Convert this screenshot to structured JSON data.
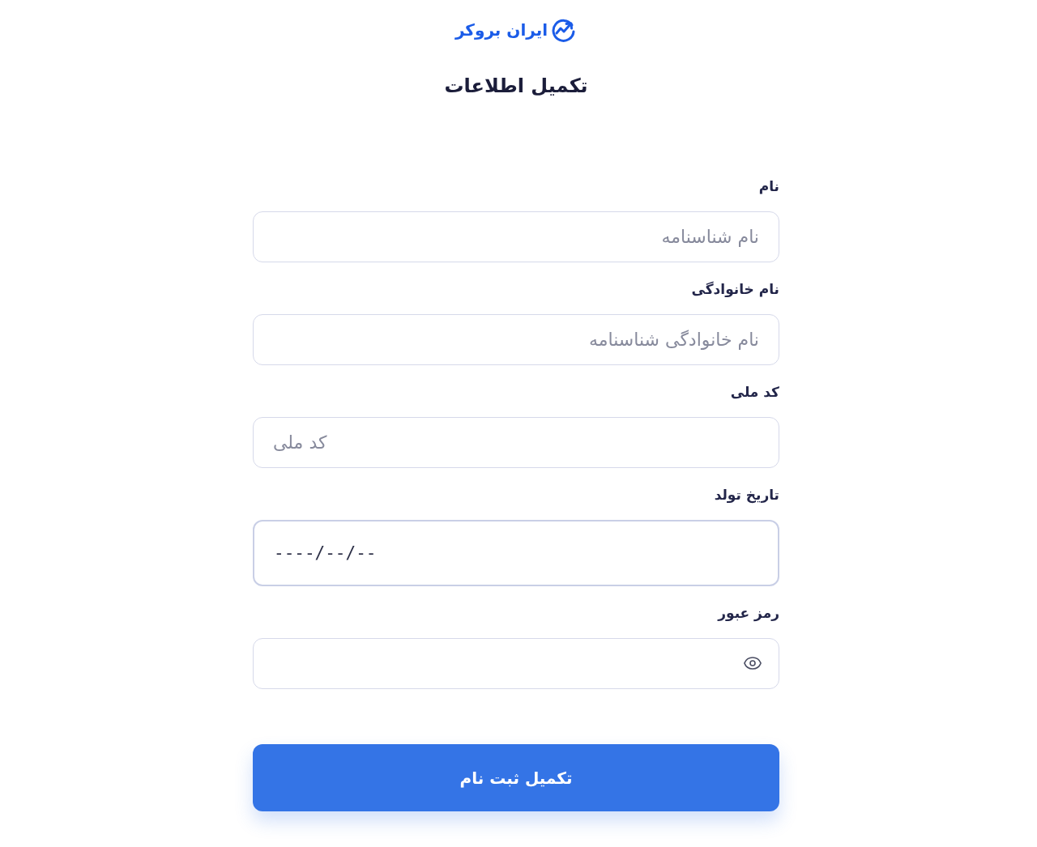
{
  "logo": {
    "text": "ایران بروکر"
  },
  "title": "تکمیل اطلاعات",
  "fields": [
    {
      "kind": "text",
      "label": "نام",
      "placeholder": "نام شناسنامه"
    },
    {
      "kind": "text",
      "label": "نام خانوادگی",
      "placeholder": "نام خانوادگی شناسنامه"
    },
    {
      "kind": "number",
      "label": "کد ملی",
      "placeholder": "کد ملی"
    },
    {
      "kind": "date",
      "label": "تاریخ تولد",
      "value": "----/--/--"
    },
    {
      "kind": "password",
      "label": "رمز عبور"
    }
  ],
  "submit_button": "تکمیل ثبت نام"
}
